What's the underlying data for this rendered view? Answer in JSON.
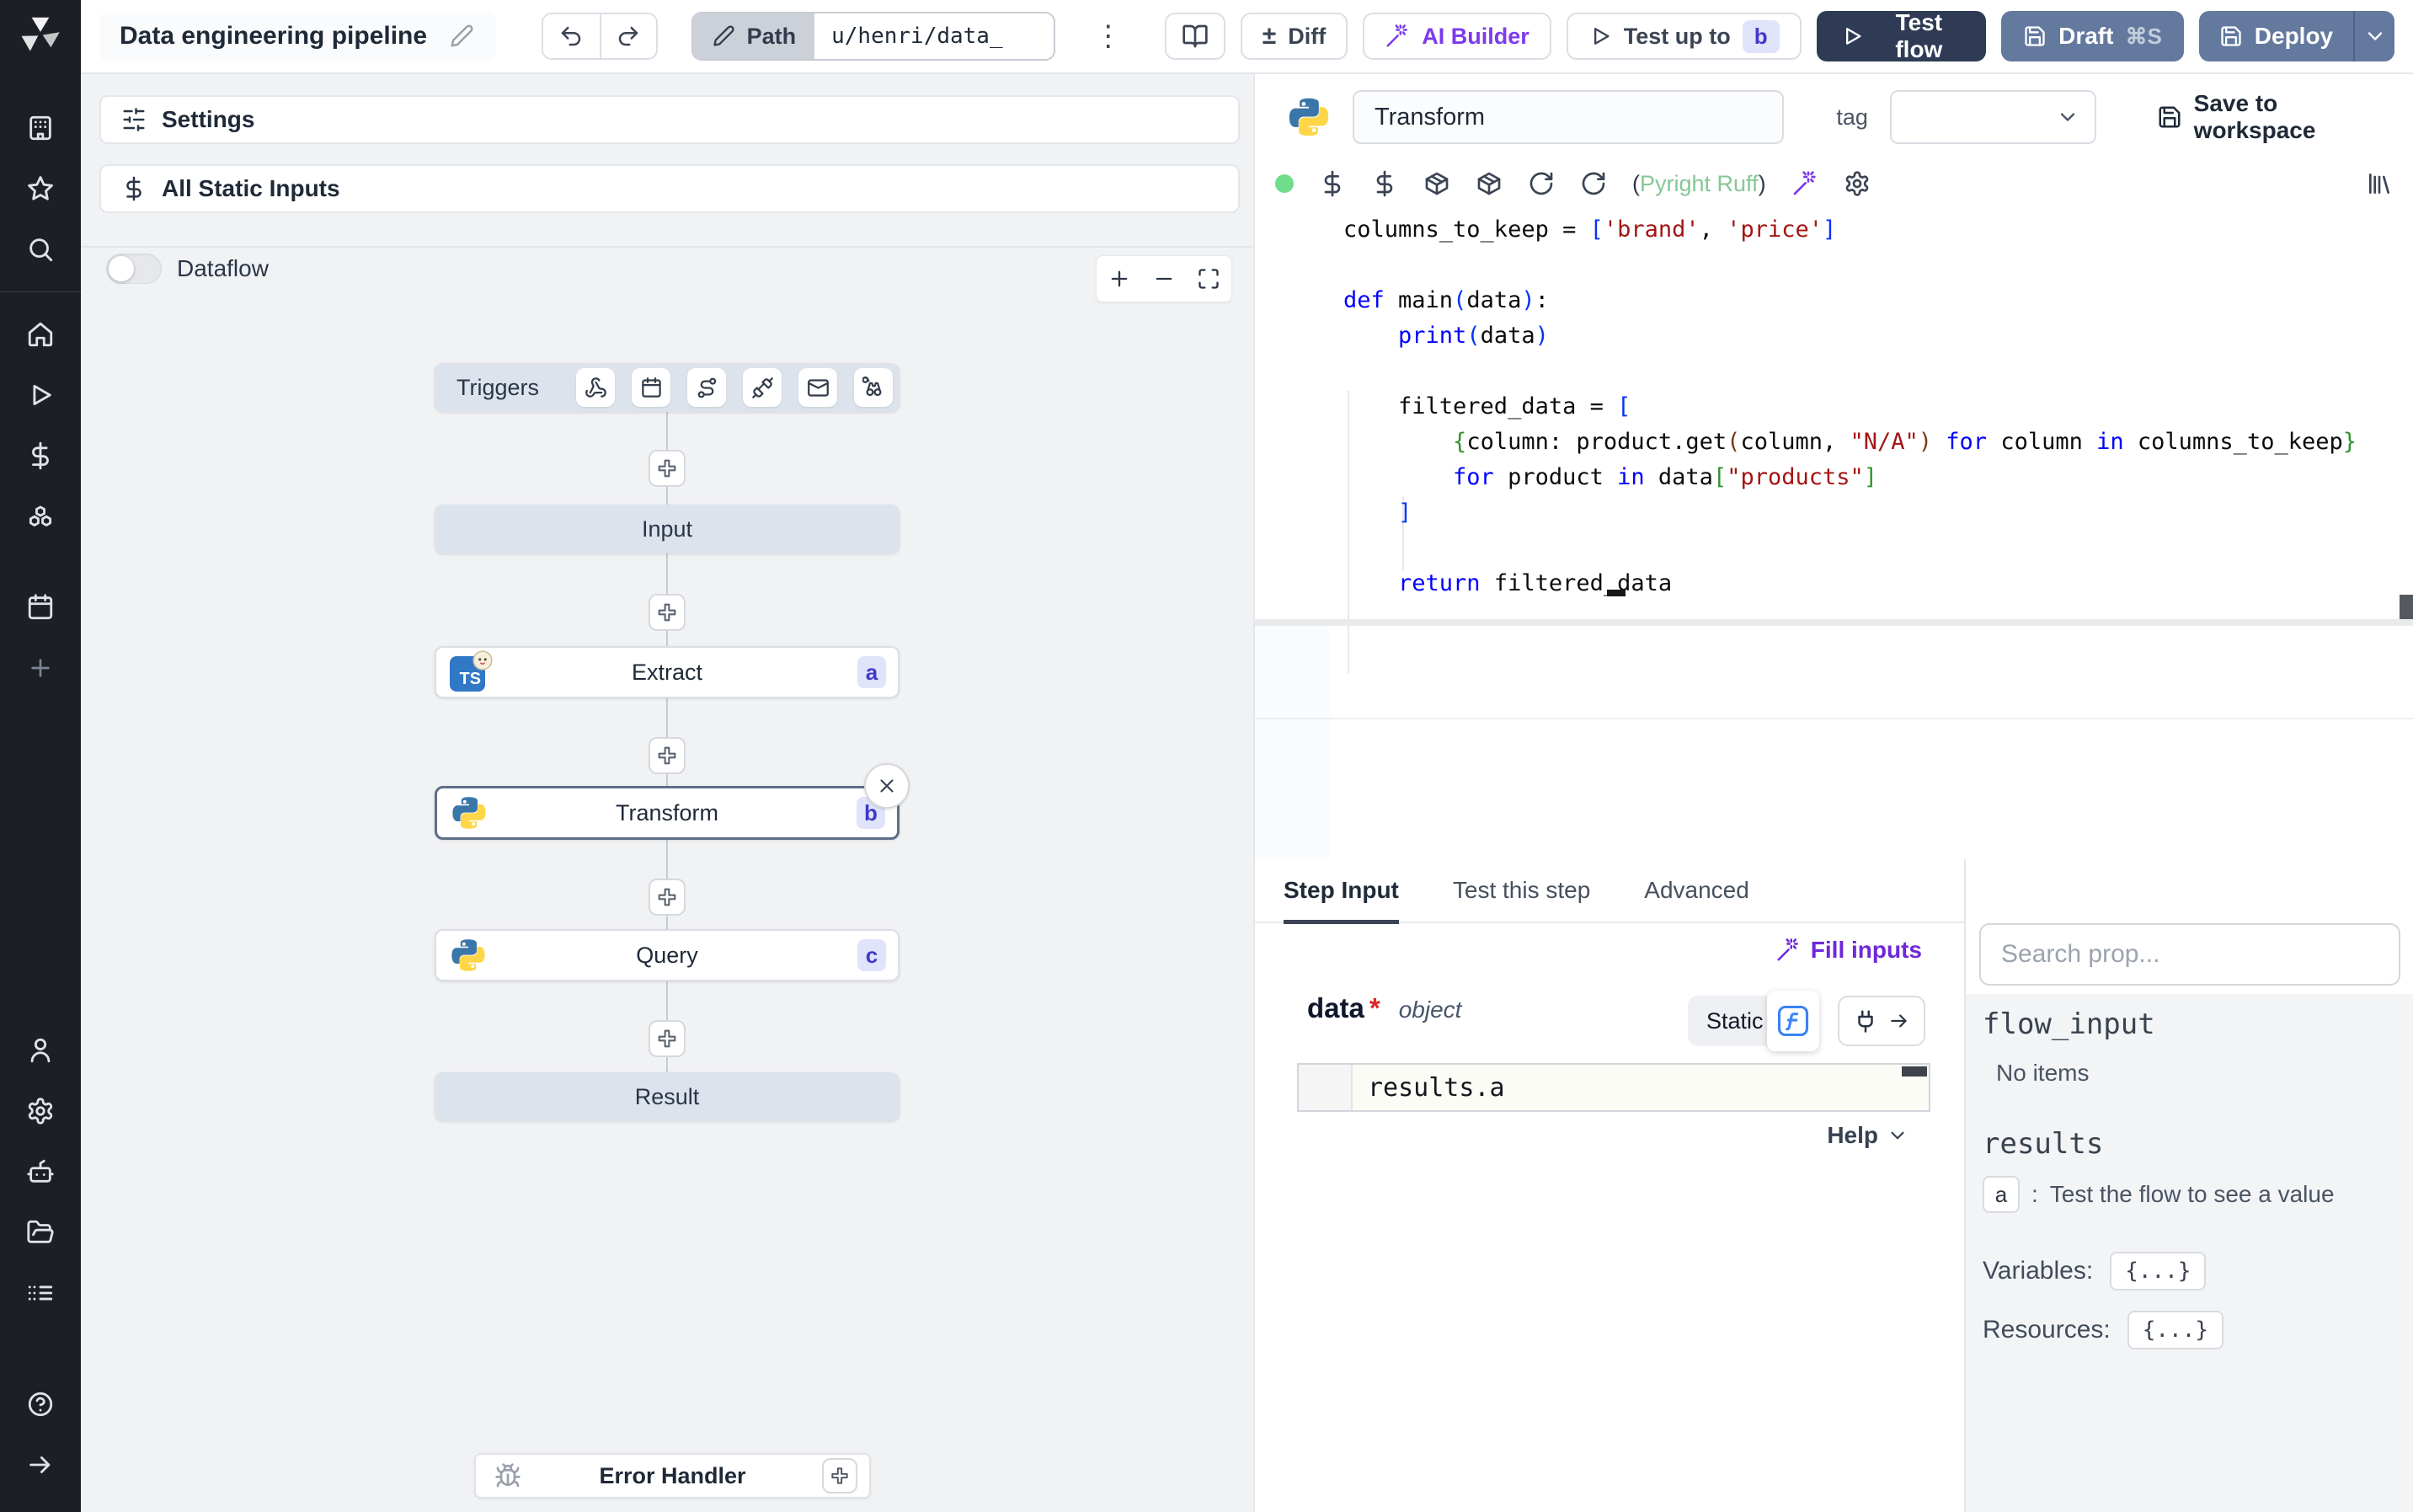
{
  "topbar": {
    "title": "Data engineering pipeline",
    "path_label": "Path",
    "path_value": "u/henri/data_",
    "diff_label": "Diff",
    "ai_builder_label": "AI Builder",
    "test_up_to_label": "Test up to",
    "test_up_to_badge": "b",
    "test_flow_label": "Test flow",
    "draft_label": "Draft",
    "draft_shortcut": "⌘S",
    "deploy_label": "Deploy"
  },
  "flow_panel": {
    "settings_label": "Settings",
    "all_static_inputs_label": "All Static Inputs",
    "dataflow_label": "Dataflow",
    "triggers_label": "Triggers",
    "nodes": {
      "input": {
        "label": "Input"
      },
      "extract": {
        "label": "Extract",
        "badge": "a",
        "language": "bun"
      },
      "transform": {
        "label": "Transform",
        "badge": "b",
        "language": "python",
        "selected": true
      },
      "query": {
        "label": "Query",
        "badge": "c",
        "language": "python"
      },
      "result": {
        "label": "Result"
      },
      "error_handler": {
        "label": "Error Handler"
      }
    }
  },
  "editor": {
    "step_name": "Transform",
    "tag_label": "tag",
    "save_label": "Save to workspace",
    "linter_status_open": "(",
    "linter_status": "Pyright Ruff",
    "linter_status_close": ")",
    "code_lines": [
      [
        {
          "c": "pl",
          "t": "columns_to_keep = "
        },
        {
          "c": "b1",
          "t": "["
        },
        {
          "c": "st",
          "t": "'brand'"
        },
        {
          "c": "pl",
          "t": ", "
        },
        {
          "c": "st",
          "t": "'price'"
        },
        {
          "c": "b1",
          "t": "]"
        }
      ],
      [],
      [
        {
          "c": "kw",
          "t": "def"
        },
        {
          "c": "pl",
          "t": " main"
        },
        {
          "c": "b1",
          "t": "("
        },
        {
          "c": "pl",
          "t": "data"
        },
        {
          "c": "b1",
          "t": ")"
        },
        {
          "c": "pl",
          "t": ":"
        }
      ],
      [
        {
          "c": "pl",
          "t": "    "
        },
        {
          "c": "kw",
          "t": "print"
        },
        {
          "c": "b1",
          "t": "("
        },
        {
          "c": "pl",
          "t": "data"
        },
        {
          "c": "b1",
          "t": ")"
        }
      ],
      [],
      [
        {
          "c": "pl",
          "t": "    filtered_data = "
        },
        {
          "c": "b1",
          "t": "["
        }
      ],
      [
        {
          "c": "pl",
          "t": "        "
        },
        {
          "c": "b2",
          "t": "{"
        },
        {
          "c": "pl",
          "t": "column: product.get"
        },
        {
          "c": "b3",
          "t": "("
        },
        {
          "c": "pl",
          "t": "column, "
        },
        {
          "c": "st",
          "t": "\"N/A\""
        },
        {
          "c": "b3",
          "t": ")"
        },
        {
          "c": "pl",
          "t": " "
        },
        {
          "c": "kw",
          "t": "for"
        },
        {
          "c": "pl",
          "t": " column "
        },
        {
          "c": "kw",
          "t": "in"
        },
        {
          "c": "pl",
          "t": " columns_to_keep"
        },
        {
          "c": "b2",
          "t": "}"
        }
      ],
      [
        {
          "c": "pl",
          "t": "        "
        },
        {
          "c": "kw",
          "t": "for"
        },
        {
          "c": "pl",
          "t": " product "
        },
        {
          "c": "kw",
          "t": "in"
        },
        {
          "c": "pl",
          "t": " data"
        },
        {
          "c": "b2",
          "t": "["
        },
        {
          "c": "st",
          "t": "\"products\""
        },
        {
          "c": "b2",
          "t": "]"
        }
      ],
      [
        {
          "c": "pl",
          "t": "    "
        },
        {
          "c": "b1",
          "t": "]"
        }
      ],
      [],
      [
        {
          "c": "pl",
          "t": "    "
        },
        {
          "c": "kw",
          "t": "return"
        },
        {
          "c": "pl",
          "t": " filtered_data"
        }
      ]
    ]
  },
  "bottom": {
    "tabs": [
      {
        "label": "Step Input",
        "active": true
      },
      {
        "label": "Test this step",
        "active": false
      },
      {
        "label": "Advanced",
        "active": false
      }
    ],
    "fill_inputs_label": "Fill inputs",
    "arg": {
      "name": "data",
      "required_marker": "*",
      "type": "object"
    },
    "static_label": "Static",
    "expression": "results.a",
    "help_label": "Help"
  },
  "props_panel": {
    "search_placeholder": "Search prop...",
    "flow_input_header": "flow_input",
    "flow_input_empty": "No items",
    "results_header": "results",
    "result_item": {
      "key": "a",
      "separator": ":",
      "hint": "Test the flow to see a value"
    },
    "variables_label": "Variables:",
    "variables_value": "{...}",
    "resources_label": "Resources:",
    "resources_value": "{...}"
  },
  "icons": {
    "kebab_menu": "⋮",
    "diff": "±",
    "function": "ƒ",
    "ts_logo": "TS"
  },
  "colors": {
    "accent_indigo": "#4338ca",
    "badge_bg": "#dfe4fa",
    "purple": "#7c3aed",
    "linter_green": "#84c796",
    "node_bg": "#dce3ec",
    "selected_border": "#5f6e87",
    "primary_button": "#2f3b55",
    "secondary_button": "#64799e",
    "sidebar_bg": "#1c1f26",
    "status_dot": "#6fdd8b"
  }
}
